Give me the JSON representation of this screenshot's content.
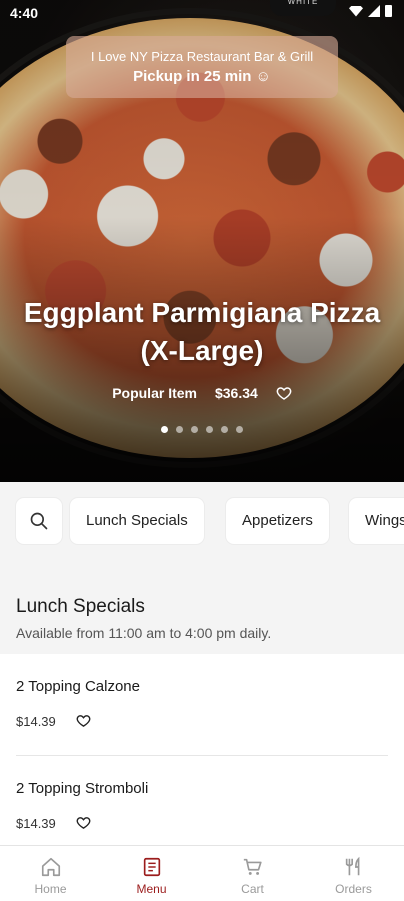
{
  "status_bar": {
    "time": "4:40"
  },
  "hero": {
    "bottle_text": "WHITE",
    "restaurant_name": "I Love NY Pizza Restaurant Bar & Grill",
    "pickup_text": "Pickup in 25 min",
    "pickup_emoji": "☺",
    "item_title": "Eggplant Parmigiana Pizza (X-Large)",
    "badge": "Popular Item",
    "price": "$36.34",
    "carousel": {
      "total": 6,
      "active_index": 0
    }
  },
  "tabs": [
    {
      "label": "Lunch Specials"
    },
    {
      "label": "Appetizers"
    },
    {
      "label": "Wings"
    }
  ],
  "section": {
    "title": "Lunch Specials",
    "subtitle": "Available from 11:00 am to 4:00 pm daily."
  },
  "items": [
    {
      "name": "2 Topping Calzone",
      "price": "$14.39"
    },
    {
      "name": "2 Topping Stromboli",
      "price": "$14.39"
    }
  ],
  "nav": [
    {
      "label": "Home",
      "icon": "home-icon",
      "active": false
    },
    {
      "label": "Menu",
      "icon": "menu-icon",
      "active": true
    },
    {
      "label": "Cart",
      "icon": "cart-icon",
      "active": false
    },
    {
      "label": "Orders",
      "icon": "orders-icon",
      "active": false
    }
  ],
  "colors": {
    "accent": "#9b1c1c",
    "inactive": "#9a9a9a"
  }
}
